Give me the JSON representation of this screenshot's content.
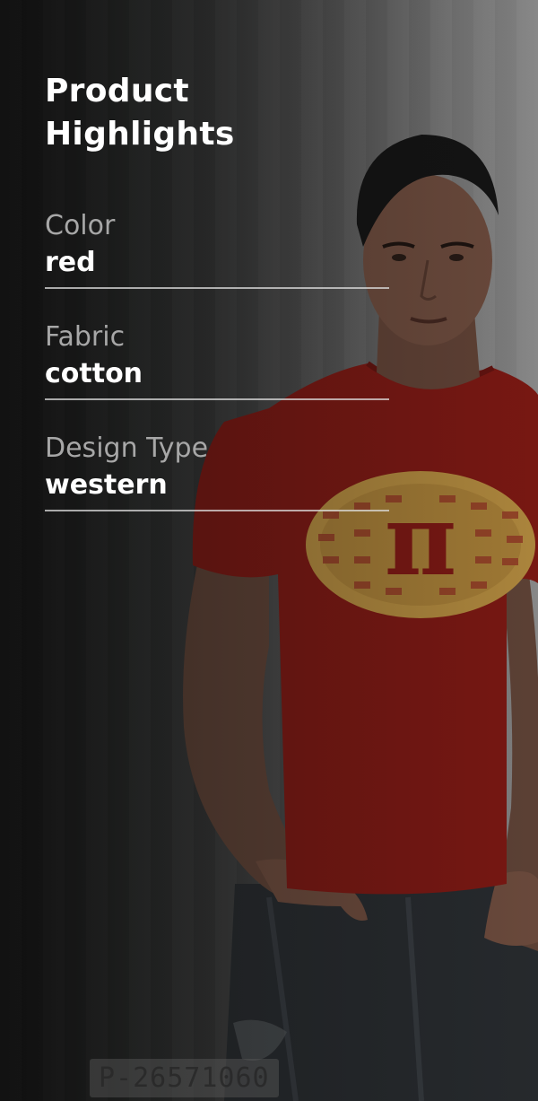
{
  "panel": {
    "title": "Product Highlights",
    "attributes": [
      {
        "label": "Color",
        "value": "red"
      },
      {
        "label": "Fabric",
        "value": "cotton"
      },
      {
        "label": "Design Type",
        "value": "western"
      }
    ]
  },
  "image": {
    "watermark": "P-26571060",
    "shirt_symbol": "π"
  },
  "colors": {
    "shirt": "#8b1a14",
    "pie": "#c79a45",
    "title": "#ffffff",
    "label": "#a7a7a7"
  }
}
